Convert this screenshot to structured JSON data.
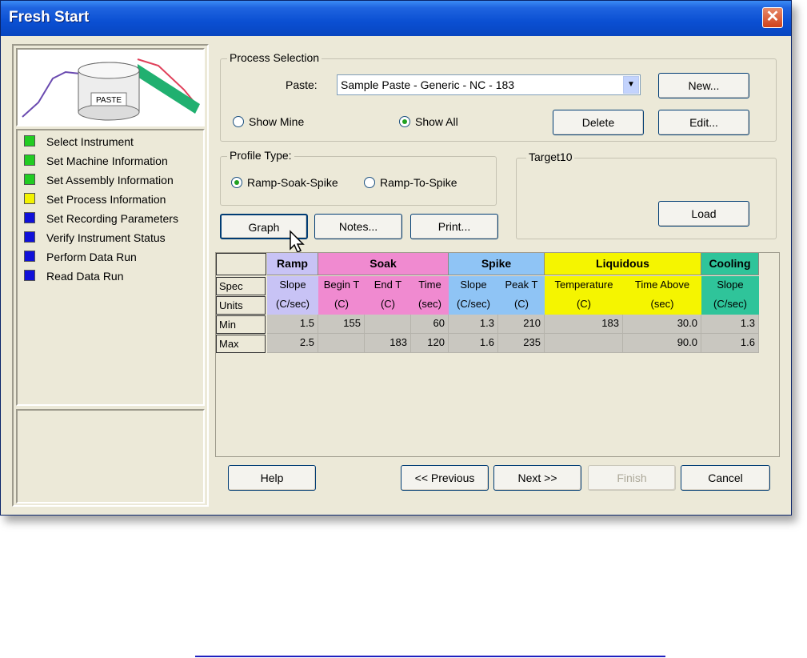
{
  "window": {
    "title": "Fresh Start",
    "close_glyph": "✕"
  },
  "image_panel": {
    "jar_label": "PASTE",
    "icon": "paste-jar-illustration-icon"
  },
  "steps": [
    {
      "label": "Select Instrument",
      "color": "#22cc22"
    },
    {
      "label": "Set Machine Information",
      "color": "#22cc22"
    },
    {
      "label": "Set Assembly Information",
      "color": "#22cc22"
    },
    {
      "label": "Set Process Information",
      "color": "#f2f200"
    },
    {
      "label": "Set Recording Parameters",
      "color": "#1010d8"
    },
    {
      "label": "Verify Instrument Status",
      "color": "#1010d8"
    },
    {
      "label": "Perform Data Run",
      "color": "#1010d8"
    },
    {
      "label": "Read Data Run",
      "color": "#1010d8"
    }
  ],
  "process_selection": {
    "group_label": "Process Selection",
    "paste_label": "Paste:",
    "paste_value": "Sample Paste - Generic - NC - 183",
    "show_mine_label": "Show Mine",
    "show_all_label": "Show All",
    "selected_filter": "Show All",
    "new_label": "New...",
    "delete_label": "Delete",
    "edit_label": "Edit..."
  },
  "profile_type": {
    "group_label": "Profile Type:",
    "option1": "Ramp-Soak-Spike",
    "option2": "Ramp-To-Spike",
    "selected": "Ramp-Soak-Spike"
  },
  "target": {
    "group_label": "Target10",
    "load_label": "Load"
  },
  "actions": {
    "graph_label": "Graph",
    "notes_label": "Notes...",
    "print_label": "Print..."
  },
  "table": {
    "groups": [
      {
        "label": "Ramp",
        "color": "#c8c3f5"
      },
      {
        "label": "Soak",
        "color": "#f08ad0"
      },
      {
        "label": "Spike",
        "color": "#8fc4f5"
      },
      {
        "label": "Liquidous",
        "color": "#f5f500"
      },
      {
        "label": "Cooling",
        "color": "#2fc49a"
      }
    ],
    "row_labels": {
      "spec": "Spec",
      "units": "Units",
      "min": "Min",
      "max": "Max"
    },
    "columns": [
      {
        "spec": "Slope",
        "unit": "(C/sec)",
        "min": "1.5",
        "max": "2.5"
      },
      {
        "spec": "Begin T",
        "unit": "(C)",
        "min": "155",
        "max": ""
      },
      {
        "spec": "End T",
        "unit": "(C)",
        "min": "",
        "max": "183"
      },
      {
        "spec": "Time",
        "unit": "(sec)",
        "min": "60",
        "max": "120"
      },
      {
        "spec": "Slope",
        "unit": "(C/sec)",
        "min": "1.3",
        "max": "1.6"
      },
      {
        "spec": "Peak T",
        "unit": "(C)",
        "min": "210",
        "max": "235"
      },
      {
        "spec": "Temperature",
        "unit": "(C)",
        "min": "183",
        "max": ""
      },
      {
        "spec": "Time Above",
        "unit": "(sec)",
        "min": "30.0",
        "max": "90.0"
      },
      {
        "spec": "Slope",
        "unit": "(C/sec)",
        "min": "1.3",
        "max": "1.6"
      }
    ]
  },
  "footer": {
    "help_label": "Help",
    "previous_label": "<< Previous",
    "next_label": "Next >>",
    "finish_label": "Finish",
    "cancel_label": "Cancel"
  }
}
